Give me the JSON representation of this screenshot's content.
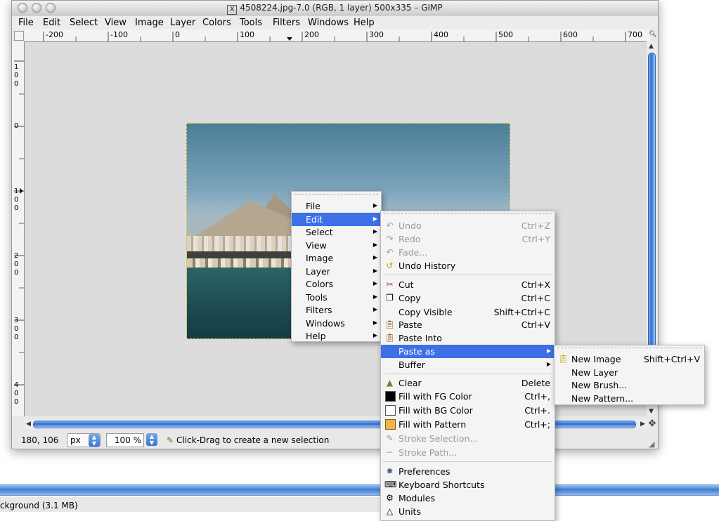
{
  "window": {
    "title": "4508224.jpg-7.0 (RGB, 1 layer) 500x335 – GIMP",
    "menubar": [
      "File",
      "Edit",
      "Select",
      "View",
      "Image",
      "Layer",
      "Colors",
      "Tools",
      "Filters",
      "Windows",
      "Help"
    ]
  },
  "rulers": {
    "horizontal": [
      "-200",
      "-100",
      "0",
      "100",
      "200",
      "300",
      "400",
      "500",
      "600",
      "700"
    ],
    "vertical": [
      "100",
      "0",
      "100",
      "200",
      "300",
      "400"
    ]
  },
  "status": {
    "coords": "180, 106",
    "unit": "px",
    "zoom": "100 %",
    "hint": "Click-Drag to create a new selection"
  },
  "background_status": "ckground (3.1 MB)",
  "context_menu": {
    "items": [
      "File",
      "Edit",
      "Select",
      "View",
      "Image",
      "Layer",
      "Colors",
      "Tools",
      "Filters",
      "Windows",
      "Help"
    ],
    "highlighted": "Edit"
  },
  "edit_menu": {
    "undo": "Undo",
    "undo_acc": "Ctrl+Z",
    "redo": "Redo",
    "redo_acc": "Ctrl+Y",
    "fade": "Fade...",
    "undo_history": "Undo History",
    "cut": "Cut",
    "cut_acc": "Ctrl+X",
    "copy": "Copy",
    "copy_acc": "Ctrl+C",
    "copy_visible": "Copy Visible",
    "copy_visible_acc": "Shift+Ctrl+C",
    "paste": "Paste",
    "paste_acc": "Ctrl+V",
    "paste_into": "Paste Into",
    "paste_as": "Paste as",
    "buffer": "Buffer",
    "clear": "Clear",
    "clear_acc": "Delete",
    "fill_fg": "Fill with FG Color",
    "fill_fg_acc": "Ctrl+,",
    "fill_bg": "Fill with BG Color",
    "fill_bg_acc": "Ctrl+.",
    "fill_pattern": "Fill with Pattern",
    "fill_pattern_acc": "Ctrl+;",
    "stroke_selection": "Stroke Selection...",
    "stroke_path": "Stroke Path...",
    "preferences": "Preferences",
    "keyboard_shortcuts": "Keyboard Shortcuts",
    "modules": "Modules",
    "units": "Units"
  },
  "paste_as_menu": {
    "new_image": "New Image",
    "new_image_acc": "Shift+Ctrl+V",
    "new_layer": "New Layer",
    "new_brush": "New Brush...",
    "new_pattern": "New Pattern..."
  },
  "colors": {
    "highlight": "#3d6fe6",
    "scroll_blue": "#2f6fd0"
  }
}
